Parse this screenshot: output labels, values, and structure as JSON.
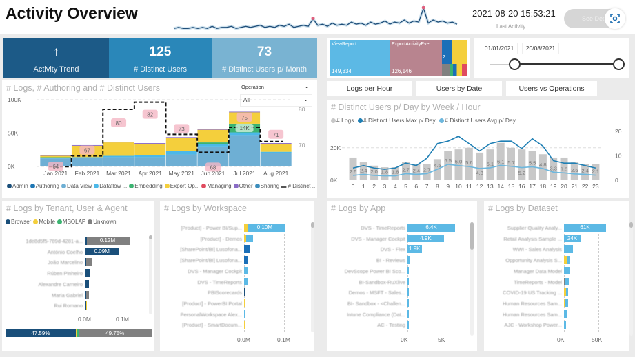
{
  "header": {
    "title": "Activity Overview",
    "last_activity_value": "2021-08-20 15:53:21",
    "last_activity_label": "Last Activity",
    "see_details_label": "See Details",
    "focus_icon": "focus-mode-icon",
    "sparkline": [
      3,
      4,
      3,
      3,
      4,
      3,
      4,
      3,
      5,
      3,
      4,
      4,
      5,
      3,
      4,
      5,
      4,
      5,
      6,
      4,
      5,
      4,
      6,
      5,
      7,
      4,
      5,
      6,
      5,
      12,
      6,
      7,
      5,
      8,
      6,
      7,
      6,
      9,
      7,
      8,
      6,
      9,
      7,
      8,
      10,
      7,
      9,
      8,
      11,
      8,
      10,
      9,
      22,
      8,
      11,
      9,
      10,
      8,
      9,
      7
    ],
    "sparkline_color": "#1f4e79",
    "marker_color": "#e0607e"
  },
  "kpis": [
    {
      "value": "↑",
      "label": "Activity Trend",
      "color": "#1c5a87"
    },
    {
      "value": "125",
      "label": "# Distinct Users",
      "color": "#2a87b9"
    },
    {
      "value": "73",
      "label": "# Distinct Users p/ Month",
      "color": "#79b3d2"
    }
  ],
  "treemap": [
    {
      "label": "ViewReport",
      "value": "149,334",
      "color": "#5cb9e5"
    },
    {
      "label": "ExportActivityEve...",
      "value": "126,146",
      "color": "#b8848f"
    },
    {
      "label": "2...",
      "value": "",
      "color": "#1b6fb8"
    }
  ],
  "date_slicer": {
    "start": "01/01/2021",
    "end": "20/08/2021",
    "start_pos": 0,
    "end_pos": 1
  },
  "tabs": [
    "Logs per Hour",
    "Users by Date",
    "Users vs Operations"
  ],
  "monthly_chart": {
    "title": "# Logs, # Authoring and # Distinct Users",
    "filter_label": "Operation",
    "filter_value": "All",
    "chart_data": {
      "type": "bar",
      "stacked": true,
      "categories": [
        "Jan 2021",
        "Feb 2021",
        "Mar 2021",
        "Apr 2021",
        "May 2021",
        "Jun 2021",
        "Jul 2021",
        "Aug 2021"
      ],
      "y_ticks": [
        "0K",
        "50K",
        "100K"
      ],
      "ylim": [
        0,
        100000
      ],
      "y2_ticks": [
        "70",
        "80"
      ],
      "series": [
        {
          "name": "Admin",
          "color": "#1a4f7a",
          "values": [
            0,
            0,
            0,
            0,
            0,
            0,
            0,
            0
          ]
        },
        {
          "name": "Authoring",
          "color": "#1f77b4",
          "values": [
            0,
            0,
            0,
            0,
            0,
            0,
            0,
            0
          ]
        },
        {
          "name": "Data View",
          "color": "#6eafd4",
          "values": [
            12000,
            13000,
            14000,
            14000,
            18000,
            30000,
            47000,
            20000
          ]
        },
        {
          "name": "Dataflow ...",
          "color": "#4cb8e8",
          "values": [
            1000,
            1000,
            2000,
            3000,
            5000,
            4000,
            4000,
            2000
          ]
        },
        {
          "name": "Embedding",
          "color": "#3cb371",
          "values": [
            1000,
            0,
            0,
            0,
            0,
            2000,
            13000,
            0
          ]
        },
        {
          "name": "Export Op...",
          "color": "#f4cf3c",
          "values": [
            2000,
            17000,
            20000,
            17000,
            20000,
            19000,
            17000,
            12000
          ]
        },
        {
          "name": "Managing",
          "color": "#e04b5f",
          "values": [
            0,
            0,
            0,
            0,
            0,
            0,
            0,
            0
          ]
        },
        {
          "name": "Other",
          "color": "#8a6cc6",
          "values": [
            1000,
            1000,
            1000,
            1000,
            1000,
            1000,
            1000,
            1000
          ]
        },
        {
          "name": "Sharing",
          "color": "#3c8dbc",
          "values": [
            0,
            0,
            0,
            0,
            0,
            0,
            0,
            0
          ]
        }
      ],
      "line": {
        "name": "# Distinct ...",
        "values": [
          64,
          67,
          80,
          82,
          73,
          68,
          75,
          71
        ],
        "axis": "right"
      },
      "annotation": "14K",
      "grid": true,
      "legend": "bottom"
    }
  },
  "hourly_chart": {
    "title": "# Distinct Users p/ Day by Week / Hour",
    "chart_data": {
      "type": "bar",
      "categories": [
        "0",
        "1",
        "2",
        "3",
        "4",
        "5",
        "6",
        "7",
        "8",
        "9",
        "10",
        "11",
        "12",
        "13",
        "14",
        "15",
        "16",
        "17",
        "18",
        "19",
        "20",
        "21",
        "22",
        "23"
      ],
      "y_ticks": [
        "0K",
        "20K"
      ],
      "y2_ticks": [
        "0",
        "10",
        "20"
      ],
      "ylim": [
        0,
        25000
      ],
      "y2lim": [
        0,
        20
      ],
      "series": [
        {
          "name": "# Logs",
          "type": "bar",
          "color": "#c8c8c8",
          "values": [
            14000,
            11000,
            9000,
            8000,
            8000,
            11000,
            10000,
            10000,
            13000,
            18000,
            19000,
            20000,
            17000,
            19000,
            23000,
            20000,
            19000,
            18000,
            16000,
            14000,
            14000,
            11000,
            10000,
            10000
          ]
        },
        {
          "name": "# Distinct Users Max p/ Day",
          "type": "line",
          "color": "#1f7fb4",
          "values": [
            5,
            6,
            5,
            4.5,
            5,
            7,
            6,
            9,
            15,
            16,
            18,
            15,
            12,
            15,
            16,
            16,
            13,
            17,
            14,
            8,
            7,
            7,
            6,
            5
          ]
        },
        {
          "name": "# Distinct Users Avg p/ Day",
          "type": "line",
          "color": "#6db7dd",
          "values": [
            2.0,
            2.4,
            2.0,
            1.8,
            1.8,
            2.7,
            2.4,
            2.7,
            4.5,
            6.5,
            6.0,
            5.6,
            4.8,
            5.1,
            6.1,
            5.7,
            5.2,
            5.5,
            4.8,
            3.3,
            3.0,
            2.6,
            2.4,
            2.1
          ]
        }
      ],
      "data_labels": [
        "2.6",
        "2.4",
        "2.0",
        "1.8",
        "1.8",
        "2.7",
        "2.4",
        "2.7",
        "4.5",
        "6.5",
        "6.0",
        "5.6",
        "4.8",
        "5.1",
        "6.1",
        "5.7",
        "5.2",
        "5.5",
        "4.8",
        "3.3",
        "3.0",
        "2.6",
        "2.4",
        "2.1"
      ],
      "grid": true,
      "legend": "top-left"
    }
  },
  "tenant_chart": {
    "title": "# Logs by Tenant, User & Agent",
    "legend": [
      {
        "name": "Browser",
        "color": "#1a4f7a"
      },
      {
        "name": "Mobile",
        "color": "#f4cf3c"
      },
      {
        "name": "MSOLAP",
        "color": "#3cb371"
      },
      {
        "name": "Unknown",
        "color": "#808080"
      }
    ],
    "chart_data": {
      "type": "bar",
      "orientation": "horizontal",
      "x_ticks": [
        "0.0M",
        "0.1M"
      ],
      "xlim": [
        0,
        0.1
      ],
      "rows": [
        {
          "label": "1de8d5f5-789d-4281-a...",
          "values": [
            0.005,
            0,
            0,
            0.115
          ],
          "data_label": "0.12M"
        },
        {
          "label": "António Coelho",
          "values": [
            0.09,
            0,
            0,
            0
          ],
          "data_label": "0.09M"
        },
        {
          "label": "João Marcelino",
          "values": [
            0.002,
            0,
            0,
            0.018
          ]
        },
        {
          "label": "Rúben Pinheiro",
          "values": [
            0.015,
            0,
            0,
            0
          ]
        },
        {
          "label": "Alexandre Carneiro",
          "values": [
            0.01,
            0,
            0,
            0
          ]
        },
        {
          "label": "Maria Gabriel",
          "values": [
            0.001,
            0,
            0,
            0.009
          ]
        },
        {
          "label": "Rui Romano",
          "values": [
            0.002,
            0.002,
            0,
            0
          ]
        }
      ]
    },
    "share_bar": [
      {
        "value": 47.59,
        "label": "47.59%",
        "color": "#1a4f7a"
      },
      {
        "value": 1.2,
        "label": "",
        "color": "#f4cf3c"
      },
      {
        "value": 0.6,
        "label": "",
        "color": "#3cb371"
      },
      {
        "value": 49.75,
        "label": "49.75%",
        "color": "#808080"
      }
    ]
  },
  "workspace_chart": {
    "title": "# Logs by Workspace",
    "chart_data": {
      "type": "bar",
      "orientation": "horizontal",
      "x_ticks": [
        "0.0M",
        "0.1M"
      ],
      "xlim": [
        0,
        0.1
      ],
      "rows": [
        {
          "label": "[Product] - Power BI/Sup...",
          "values": [
            0.008,
            0.095
          ],
          "colors": [
            "#f4cf3c",
            "#5cb9e5"
          ],
          "data_label": "0.10M"
        },
        {
          "label": "[Product] - Demos",
          "values": [
            0.006,
            0.017
          ],
          "colors": [
            "#f4cf3c",
            "#5cb9e5"
          ]
        },
        {
          "label": "[SharePoint/BI] Lusofona...",
          "values": [
            0.013
          ],
          "colors": [
            "#1b6fb8"
          ]
        },
        {
          "label": "[SharePoint/BI] Lusofona...",
          "values": [
            0.011
          ],
          "colors": [
            "#1b6fb8"
          ]
        },
        {
          "label": "DVS - Manager Cockpit",
          "values": [
            0.009
          ],
          "colors": [
            "#5cb9e5"
          ]
        },
        {
          "label": "DVS - TimeReports",
          "values": [
            0.008
          ],
          "colors": [
            "#5cb9e5"
          ]
        },
        {
          "label": "PBIScorecards",
          "values": [
            0.004
          ],
          "colors": [
            "#1a4f7a"
          ]
        },
        {
          "label": "[Product] - PowerBI Portal",
          "values": [
            0.004
          ],
          "colors": [
            "#f4cf3c"
          ]
        },
        {
          "label": "PersonalWorkspace Alex...",
          "values": [
            0.004
          ],
          "colors": [
            "#5cb9e5"
          ]
        },
        {
          "label": "[Product] - SmartDocum...",
          "values": [
            0.003
          ],
          "colors": [
            "#f4cf3c"
          ]
        }
      ]
    }
  },
  "app_chart": {
    "title": "# Logs by App",
    "chart_data": {
      "type": "bar",
      "orientation": "horizontal",
      "x_ticks": [
        "0K",
        "5K"
      ],
      "xlim": [
        0,
        5000
      ],
      "rows": [
        {
          "label": "DVS - TimeReports",
          "values": [
            6400
          ],
          "colors": [
            "#5cb9e5"
          ],
          "data_label": "6.4K"
        },
        {
          "label": "DVS - Manager Cockpit",
          "values": [
            4900
          ],
          "colors": [
            "#5cb9e5"
          ],
          "data_label": "4.9K"
        },
        {
          "label": "DVS - Flex",
          "values": [
            1900
          ],
          "colors": [
            "#5cb9e5"
          ],
          "data_label": "1.9K"
        },
        {
          "label": "BI - Reviews",
          "values": [
            300
          ],
          "colors": [
            "#5cb9e5"
          ]
        },
        {
          "label": "DevScope Power BI Sco...",
          "values": [
            150
          ],
          "colors": [
            "#5cb9e5"
          ]
        },
        {
          "label": "BI-Sandbox-RuXlive",
          "values": [
            50
          ],
          "colors": [
            "#5cb9e5"
          ]
        },
        {
          "label": "Demos - MSFT - Sales...",
          "values": [
            50
          ],
          "colors": [
            "#5cb9e5"
          ]
        },
        {
          "label": "BI- Sandbox - <Challen...",
          "values": [
            30
          ],
          "colors": [
            "#5cb9e5"
          ]
        },
        {
          "label": "Intune Compliance (Dat...",
          "values": [
            20
          ],
          "colors": [
            "#5cb9e5"
          ]
        },
        {
          "label": "AC - Testing",
          "values": [
            10
          ],
          "colors": [
            "#5cb9e5"
          ]
        }
      ]
    }
  },
  "dataset_chart": {
    "title": "# Logs by Dataset",
    "chart_data": {
      "type": "bar",
      "orientation": "horizontal",
      "x_ticks": [
        "0K",
        "50K"
      ],
      "xlim": [
        0,
        50000
      ],
      "rows": [
        {
          "label": "Supplier Quality Analy...",
          "values": [
            61000
          ],
          "colors": [
            "#5cb9e5"
          ],
          "data_label": "61K"
        },
        {
          "label": "Retail Analysis Sample ...",
          "values": [
            24000
          ],
          "colors": [
            "#5cb9e5"
          ],
          "data_label": "24K"
        },
        {
          "label": "WWI - Sales Analysis",
          "values": [
            13000
          ],
          "colors": [
            "#5cb9e5"
          ]
        },
        {
          "label": "Opportunity Analysis S...",
          "values": [
            5000,
            4000
          ],
          "colors": [
            "#f4cf3c",
            "#5cb9e5"
          ]
        },
        {
          "label": "Manager Data Model",
          "values": [
            8000
          ],
          "colors": [
            "#5cb9e5"
          ]
        },
        {
          "label": "TimeReports - Model",
          "values": [
            2000,
            5000
          ],
          "colors": [
            "#808080",
            "#5cb9e5"
          ]
        },
        {
          "label": "COVID-19 US Tracking ...",
          "values": [
            3000,
            3000
          ],
          "colors": [
            "#f4cf3c",
            "#5cb9e5"
          ]
        },
        {
          "label": "Human Resources Sam...",
          "values": [
            1500,
            4000
          ],
          "colors": [
            "#f4cf3c",
            "#5cb9e5"
          ]
        },
        {
          "label": "Human Resources Sam...",
          "values": [
            3500
          ],
          "colors": [
            "#5cb9e5"
          ]
        },
        {
          "label": "AJC - Workshop Power...",
          "values": [
            3000
          ],
          "colors": [
            "#5cb9e5"
          ]
        }
      ]
    }
  }
}
